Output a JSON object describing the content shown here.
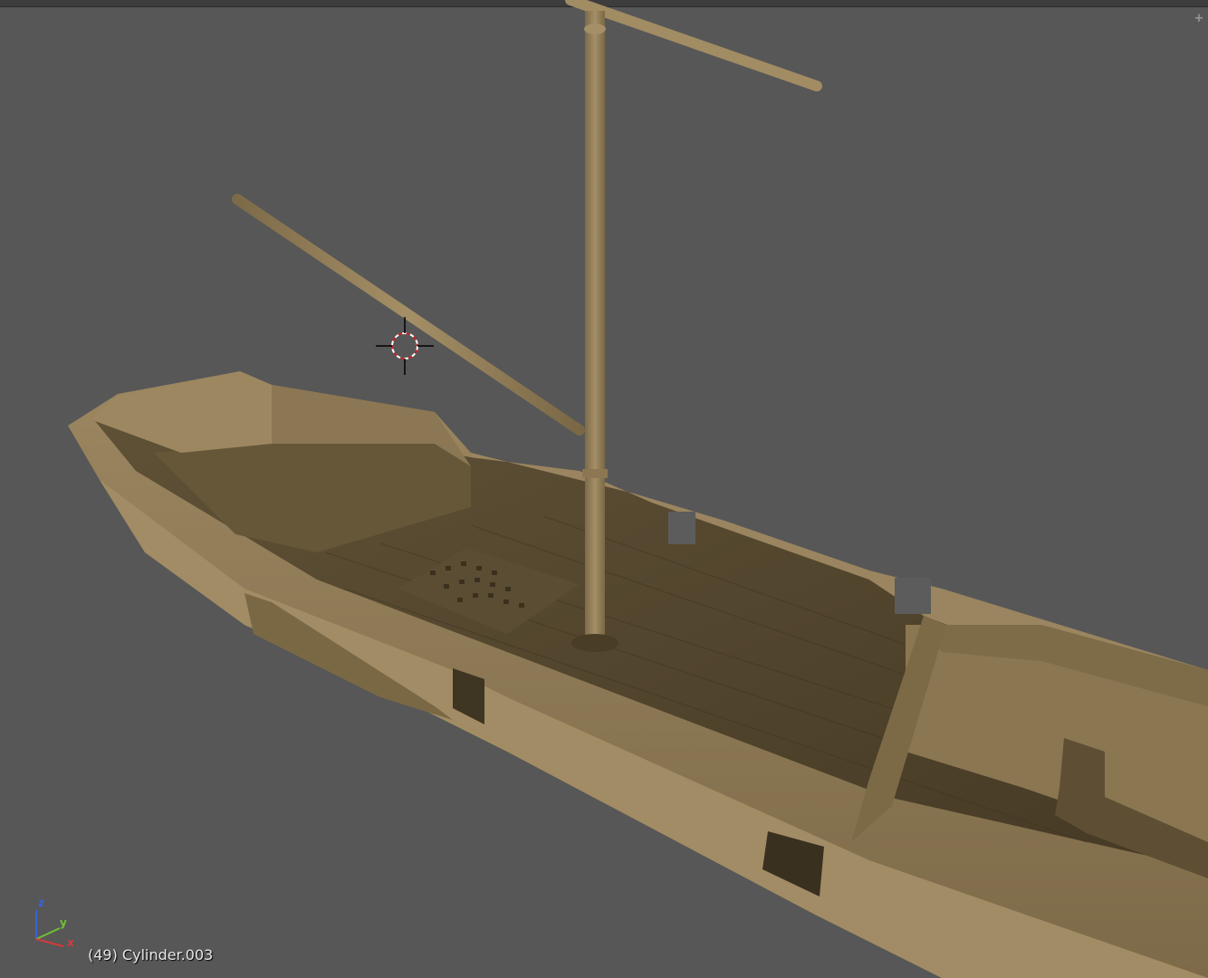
{
  "viewport": {
    "background": "#575757",
    "active_object_info": "(49) Cylinder.003"
  },
  "axis_gizmo": {
    "x_label": "x",
    "y_label": "y",
    "z_label": "z",
    "x_color": "#d33a3a",
    "y_color": "#6ec234",
    "z_color": "#3a62d6"
  },
  "scene": {
    "model_color": "#8a7550",
    "icons": [
      "3d-cursor-icon",
      "add-region-icon"
    ]
  }
}
